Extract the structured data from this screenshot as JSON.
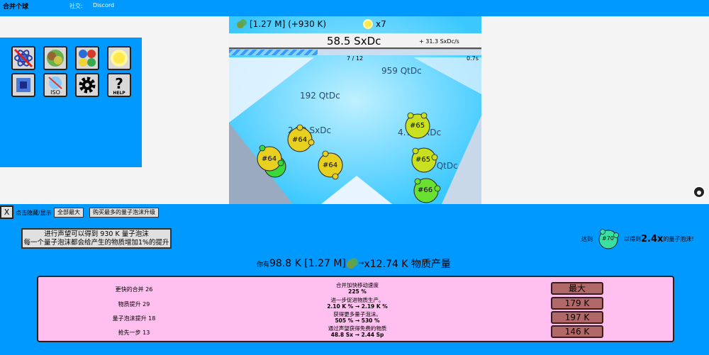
{
  "app": {
    "title": "合并个球",
    "social_label": "社交:",
    "discord_label": "Discord"
  },
  "icons": [
    "atom-icon",
    "merge-icon",
    "planets-icon",
    "sun-icon",
    "chip-icon",
    "iso-icon",
    "gear-icon",
    "help-icon"
  ],
  "icon_labels": {
    "iso": "ISO",
    "help": "HELP"
  },
  "hud": {
    "resource": "[1.27 M] (+930 K)",
    "multiplier": "x7",
    "main_value": "58.5 SxDc",
    "rate": "+ 31.3 SxDc/s",
    "progress_text": "7 / 12",
    "timer": "0.7s",
    "progress_fraction": 0.35
  },
  "floating_texts": [
    "959 QtDc",
    "192 QtDc",
    "24.0 SxDc",
    "4.79 SxDc",
    "959 QtDc"
  ],
  "orbs": [
    "#64",
    "#64",
    "#64",
    "#65",
    "#65",
    "#66"
  ],
  "controls": {
    "close": "X",
    "hint": "点击隐藏/显示",
    "all_max": "全部最大",
    "buy_most": "购买最多的量子泡沫升级"
  },
  "prestige": {
    "line1": "进行声望可以得到 930 K 量子泡沫",
    "line2": "每一个量子泡沫都会给产生的物质增加1%的提升"
  },
  "reach": {
    "prefix": "达到",
    "target": "#70",
    "middle": "以得到",
    "mult": "2.4x",
    "suffix": "的量子泡沫!"
  },
  "have": {
    "prefix": "你有",
    "amount": "98.8 K [1.27 M]",
    "arrow": "→",
    "mult": "x12.74 K 物质产量"
  },
  "upgrades": [
    {
      "name": "更快的合并 26",
      "desc": "合并加快移动速度",
      "detail": "225 %",
      "cost": "最大"
    },
    {
      "name": "物质提升 29",
      "desc": "进一步促进物质生产。",
      "detail": "2.10 K % → 2.19 K %",
      "cost": "179 K"
    },
    {
      "name": "量子泡沫提升 18",
      "desc": "获得更多量子泡沫。",
      "detail": "505 % → 530 %",
      "cost": "197 K"
    },
    {
      "name": "抢先一步 13",
      "desc": "通过声望获得免费的物质",
      "detail": "48.8 Sx → 2.44 Sp",
      "cost": "146 K"
    }
  ]
}
